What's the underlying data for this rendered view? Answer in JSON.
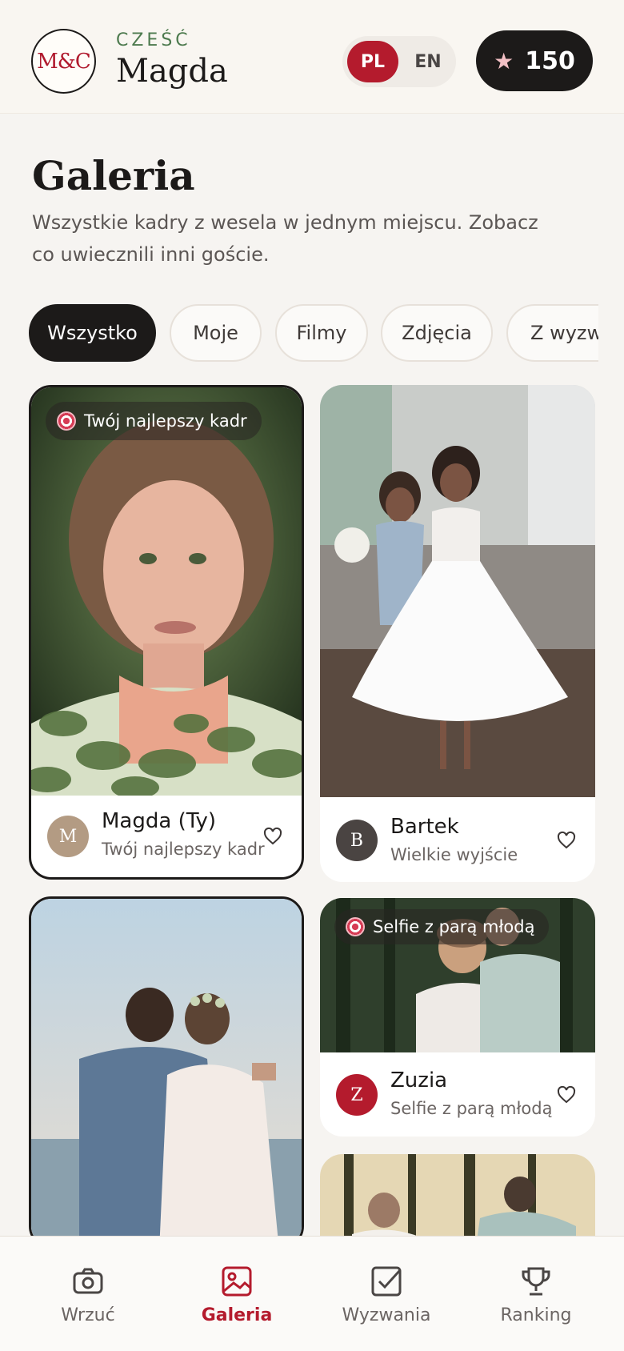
{
  "header": {
    "logo_text": "M&C",
    "greeting_label": "CZEŚĆ",
    "user_name": "Magda",
    "lang_pl": "PL",
    "lang_en": "EN",
    "points": "150",
    "accent_color": "#b41b2d"
  },
  "main": {
    "title": "Galeria",
    "subtitle": "Wszystkie kadry z wesela w jednym miejscu. Zobacz co uwiecznili inni goście."
  },
  "filters": [
    "Wszystko",
    "Moje",
    "Filmy",
    "Zdjęcia",
    "Z wyzwań"
  ],
  "active_filter": "Wszystko",
  "cards": [
    {
      "badge": "Twój najlepszy kadr",
      "avatar": "M",
      "name": "Magda (Ty)",
      "caption": "Twój najlepszy kadr",
      "mine": true
    },
    {
      "badge": "",
      "avatar": "B",
      "name": "Bartek",
      "caption": "Wielkie wyjście",
      "mine": false
    },
    {
      "badge": "",
      "avatar": "",
      "name": "",
      "caption": "",
      "mine": true
    },
    {
      "badge": "Selfie z parą młodą",
      "avatar": "Z",
      "name": "Zuzia",
      "caption": "Selfie z parą młodą",
      "mine": false
    }
  ],
  "nav": {
    "upload": "Wrzuć",
    "gallery": "Galeria",
    "challenges": "Wyzwania",
    "ranking": "Ranking",
    "active": "gallery"
  }
}
